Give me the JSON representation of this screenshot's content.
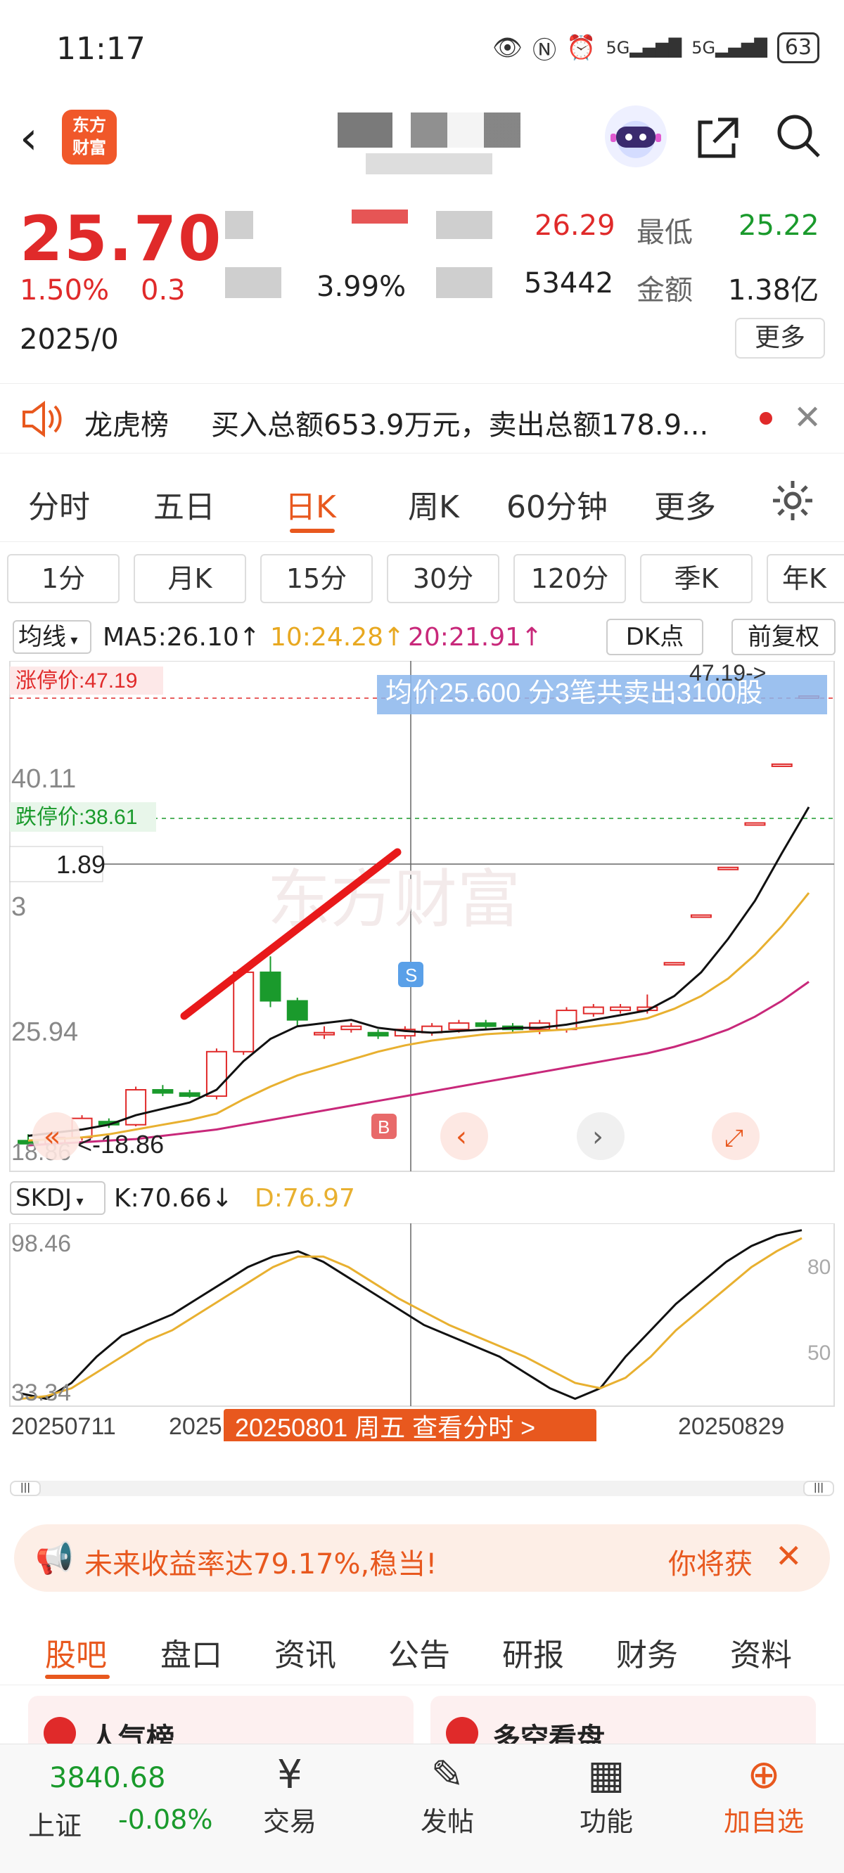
{
  "status": {
    "time": "11:17",
    "battery": "63",
    "signal1": "5G",
    "signal2": "5G"
  },
  "header": {
    "logo_line1": "东方",
    "logo_line2": "财富"
  },
  "quote": {
    "price": "25.70",
    "change_pct": "1.50%",
    "change_amt": "0.3",
    "date": "2025/0",
    "turnover_partial": "3.99%",
    "volume_partial": "53442",
    "high_partial": "26.29",
    "low_label": "最低",
    "low_value": "25.22",
    "amount_label": "金额",
    "amount_value": "1.38亿",
    "more_button": "更多"
  },
  "notice": {
    "label": "龙虎榜",
    "text": "买入总额653.9万元，卖出总额178.9..."
  },
  "period_tabs": [
    "分时",
    "五日",
    "日K",
    "周K",
    "60分钟",
    "更多"
  ],
  "sub_periods": [
    "1分",
    "月K",
    "15分",
    "30分",
    "120分",
    "季K",
    "年K"
  ],
  "indicator": {
    "type": "均线",
    "ma5": "MA5:26.10↑",
    "ma10": "10:24.28↑",
    "ma20": "20:21.91↑",
    "dk_button": "DK点",
    "adjust_button": "前复权"
  },
  "kline": {
    "limit_up_label": "涨停价:47.19",
    "limit_down_label": "跌停价:38.61",
    "tooltip": "均价25.600  分3笔共卖出3100股",
    "price_right": "47.19->",
    "cross_label": "1.89",
    "y_ticks": [
      "40.11",
      "25.94",
      "18.86"
    ],
    "min_label": "<-18.86",
    "axis_partial": "3"
  },
  "skdj": {
    "name": "SKDJ",
    "k": "K:70.66↓",
    "d": "D:76.97",
    "y_left_top": "98.46",
    "y_left_bottom": "33.34",
    "y_right_80": "80",
    "y_right_50": "50",
    "date_left": "20250711",
    "date_partial": "2025",
    "date_right": "20250829",
    "hover_label": "20250801 周五 查看分时 >"
  },
  "promo": {
    "text": "未来收益率达79.17%,稳当!",
    "right": "你将获"
  },
  "bottom_tabs": [
    "股吧",
    "盘口",
    "资讯",
    "公告",
    "研报",
    "财务",
    "资料"
  ],
  "cards": [
    "人气榜",
    "多空看盘"
  ],
  "bottom_bar": {
    "index_value": "3840.68",
    "index_name": "上证",
    "index_change": "-0.08%",
    "items": [
      "交易",
      "发帖",
      "功能",
      "加自选"
    ]
  },
  "chart_data": {
    "type": "candlestick",
    "candles": [
      {
        "o": 19.2,
        "c": 19.0,
        "h": 19.6,
        "l": 18.86
      },
      {
        "o": 19.0,
        "c": 19.4,
        "h": 19.8,
        "l": 18.9
      },
      {
        "o": 19.4,
        "c": 20.6,
        "h": 20.8,
        "l": 19.2
      },
      {
        "o": 20.4,
        "c": 20.2,
        "h": 20.6,
        "l": 20.0
      },
      {
        "o": 20.2,
        "c": 22.4,
        "h": 22.6,
        "l": 20.1
      },
      {
        "o": 22.4,
        "c": 22.2,
        "h": 22.7,
        "l": 22.0
      },
      {
        "o": 22.2,
        "c": 22.0,
        "h": 22.4,
        "l": 21.9
      },
      {
        "o": 22.0,
        "c": 24.8,
        "h": 25.0,
        "l": 21.8
      },
      {
        "o": 24.8,
        "c": 29.8,
        "h": 30.0,
        "l": 24.6
      },
      {
        "o": 29.8,
        "c": 28.0,
        "h": 30.8,
        "l": 27.6
      },
      {
        "o": 28.0,
        "c": 26.8,
        "h": 28.2,
        "l": 26.4
      },
      {
        "o": 26.0,
        "c": 26.0,
        "h": 26.4,
        "l": 25.6
      },
      {
        "o": 26.2,
        "c": 26.4,
        "h": 26.6,
        "l": 26.0
      },
      {
        "o": 26.0,
        "c": 25.8,
        "h": 26.2,
        "l": 25.6
      },
      {
        "o": 25.8,
        "c": 26.2,
        "h": 26.4,
        "l": 25.6
      },
      {
        "o": 26.0,
        "c": 26.4,
        "h": 26.6,
        "l": 25.8
      },
      {
        "o": 26.2,
        "c": 26.6,
        "h": 26.8,
        "l": 26.0
      },
      {
        "o": 26.6,
        "c": 26.4,
        "h": 26.8,
        "l": 26.2
      },
      {
        "o": 26.4,
        "c": 26.2,
        "h": 26.6,
        "l": 26.0
      },
      {
        "o": 26.2,
        "c": 26.6,
        "h": 26.8,
        "l": 25.9
      },
      {
        "o": 26.2,
        "c": 27.4,
        "h": 27.6,
        "l": 26.0
      },
      {
        "o": 27.2,
        "c": 27.6,
        "h": 27.8,
        "l": 27.0
      },
      {
        "o": 27.4,
        "c": 27.6,
        "h": 27.8,
        "l": 27.2
      },
      {
        "o": 27.4,
        "c": 27.6,
        "h": 28.4,
        "l": 27.2
      },
      {
        "o": 30.4,
        "c": 30.4,
        "h": 30.4,
        "l": 30.4
      },
      {
        "o": 33.4,
        "c": 33.4,
        "h": 33.4,
        "l": 33.4
      },
      {
        "o": 36.4,
        "c": 36.4,
        "h": 36.4,
        "l": 36.4
      },
      {
        "o": 39.2,
        "c": 39.2,
        "h": 39.2,
        "l": 39.2
      },
      {
        "o": 42.9,
        "c": 42.9,
        "h": 42.9,
        "l": 42.9
      },
      {
        "o": 47.19,
        "c": 47.19,
        "h": 47.19,
        "l": 47.19
      }
    ],
    "ma5": [
      19.5,
      19.7,
      19.9,
      20.2,
      20.8,
      21.2,
      21.6,
      22.4,
      24.2,
      25.6,
      26.4,
      26.6,
      26.8,
      26.3,
      26.1,
      26.0,
      26.1,
      26.2,
      26.3,
      26.3,
      26.5,
      26.8,
      27.1,
      27.4,
      28.3,
      29.8,
      31.9,
      34.3,
      37.3,
      40.2
    ],
    "ma10": [
      19.2,
      19.3,
      19.4,
      19.6,
      19.9,
      20.2,
      20.5,
      20.9,
      21.8,
      22.6,
      23.3,
      23.8,
      24.3,
      24.8,
      25.2,
      25.5,
      25.7,
      25.9,
      26.0,
      26.1,
      26.2,
      26.4,
      26.6,
      26.9,
      27.5,
      28.3,
      29.4,
      30.9,
      32.7,
      34.8
    ],
    "ma20": [
      18.9,
      19.0,
      19.1,
      19.2,
      19.3,
      19.5,
      19.7,
      19.9,
      20.2,
      20.5,
      20.8,
      21.1,
      21.4,
      21.7,
      22.0,
      22.3,
      22.6,
      22.9,
      23.2,
      23.5,
      23.8,
      24.1,
      24.4,
      24.7,
      25.1,
      25.6,
      26.2,
      27.0,
      28.0,
      29.2
    ],
    "ylim": [
      18.86,
      47.19
    ],
    "skdj_k": [
      36,
      34,
      40,
      50,
      58,
      62,
      66,
      72,
      78,
      84,
      88,
      90,
      86,
      80,
      74,
      68,
      62,
      58,
      54,
      50,
      44,
      38,
      34,
      38,
      50,
      60,
      70,
      78,
      86,
      92,
      96,
      98
    ],
    "skdj_d": [
      34,
      35,
      38,
      44,
      50,
      56,
      60,
      66,
      72,
      78,
      84,
      88,
      88,
      84,
      78,
      72,
      67,
      62,
      58,
      54,
      50,
      45,
      40,
      38,
      42,
      50,
      60,
      68,
      76,
      84,
      90,
      95
    ],
    "skdj_ylim": [
      33.34,
      98.46
    ]
  }
}
